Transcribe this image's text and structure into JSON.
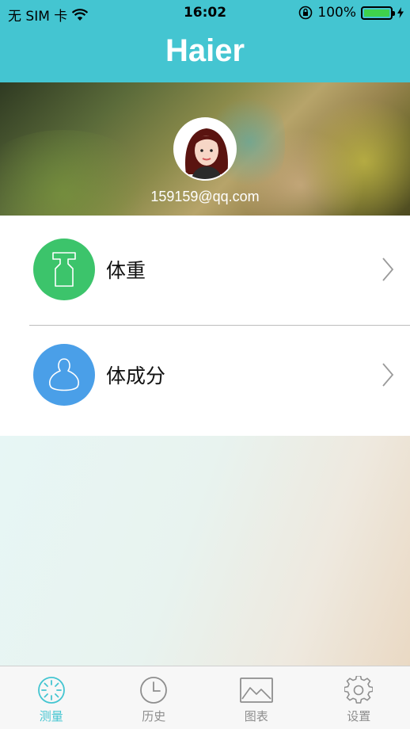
{
  "status_bar": {
    "carrier": "无 SIM 卡",
    "time": "16:02",
    "battery_percent": "100%",
    "battery_level": 1.0
  },
  "nav": {
    "logo": "Haier"
  },
  "profile": {
    "email": "159159@qq.com"
  },
  "menu": {
    "items": [
      {
        "label": "体重",
        "icon": "weight-icon",
        "color": "#3cc46b"
      },
      {
        "label": "体成分",
        "icon": "body-composition-icon",
        "color": "#4a9fe8"
      }
    ]
  },
  "tabbar": {
    "tabs": [
      {
        "label": "测量",
        "icon": "measure-icon",
        "active": true
      },
      {
        "label": "历史",
        "icon": "clock-icon",
        "active": false
      },
      {
        "label": "图表",
        "icon": "image-chart-icon",
        "active": false
      },
      {
        "label": "设置",
        "icon": "gear-icon",
        "active": false
      }
    ]
  },
  "colors": {
    "accent": "#44c5d1",
    "inactive": "#8e8e8e"
  }
}
